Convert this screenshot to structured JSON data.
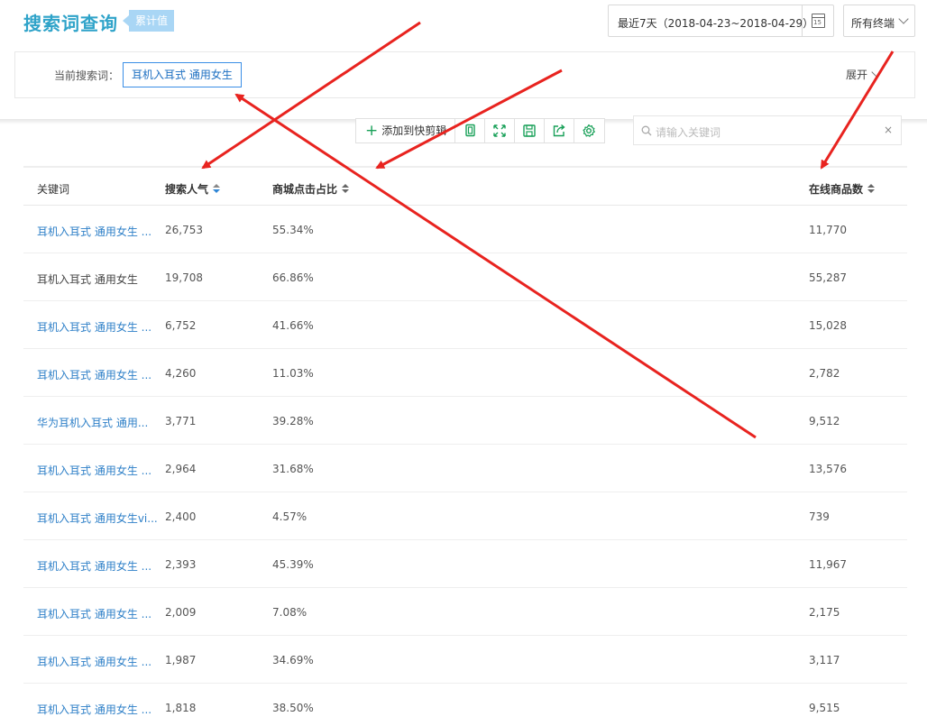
{
  "header": {
    "title": "搜索词查询",
    "badge": "累计值",
    "date_range": "最近7天（2018-04-23~2018-04-29）",
    "calendar_day": "15",
    "device": "所有终端"
  },
  "filter": {
    "label": "当前搜索词：",
    "tag": "耳机入耳式 通用女生",
    "expand": "展开"
  },
  "toolbar": {
    "add_label": "添加到快剪辑",
    "search_placeholder": "请输入关键词",
    "clear_label": "×"
  },
  "table": {
    "columns": [
      "关键词",
      "搜索人气",
      "商城点击占比",
      "在线商品数"
    ],
    "rows": [
      {
        "keyword": "耳机入耳式 通用女生 ...",
        "popularity": "26,753",
        "ratio": "55.34%",
        "items": "11,770",
        "link": true
      },
      {
        "keyword": "耳机入耳式 通用女生",
        "popularity": "19,708",
        "ratio": "66.86%",
        "items": "55,287",
        "link": false
      },
      {
        "keyword": "耳机入耳式 通用女生 ...",
        "popularity": "6,752",
        "ratio": "41.66%",
        "items": "15,028",
        "link": true
      },
      {
        "keyword": "耳机入耳式 通用女生 ...",
        "popularity": "4,260",
        "ratio": "11.03%",
        "items": "2,782",
        "link": true
      },
      {
        "keyword": "华为耳机入耳式 通用...",
        "popularity": "3,771",
        "ratio": "39.28%",
        "items": "9,512",
        "link": true
      },
      {
        "keyword": "耳机入耳式 通用女生 ...",
        "popularity": "2,964",
        "ratio": "31.68%",
        "items": "13,576",
        "link": true
      },
      {
        "keyword": "耳机入耳式 通用女生vi...",
        "popularity": "2,400",
        "ratio": "4.57%",
        "items": "739",
        "link": true
      },
      {
        "keyword": "耳机入耳式 通用女生 ...",
        "popularity": "2,393",
        "ratio": "45.39%",
        "items": "11,967",
        "link": true
      },
      {
        "keyword": "耳机入耳式 通用女生 ...",
        "popularity": "2,009",
        "ratio": "7.08%",
        "items": "2,175",
        "link": true
      },
      {
        "keyword": "耳机入耳式 通用女生 ...",
        "popularity": "1,987",
        "ratio": "34.69%",
        "items": "3,117",
        "link": true
      },
      {
        "keyword": "耳机入耳式 通用女生 ...",
        "popularity": "1,818",
        "ratio": "38.50%",
        "items": "9,515",
        "link": true
      }
    ]
  },
  "colors": {
    "title": "#2fa3c9",
    "link": "#2f80c8",
    "annotation_arrow": "#e8231f",
    "toolbar_icon": "#18a058"
  }
}
